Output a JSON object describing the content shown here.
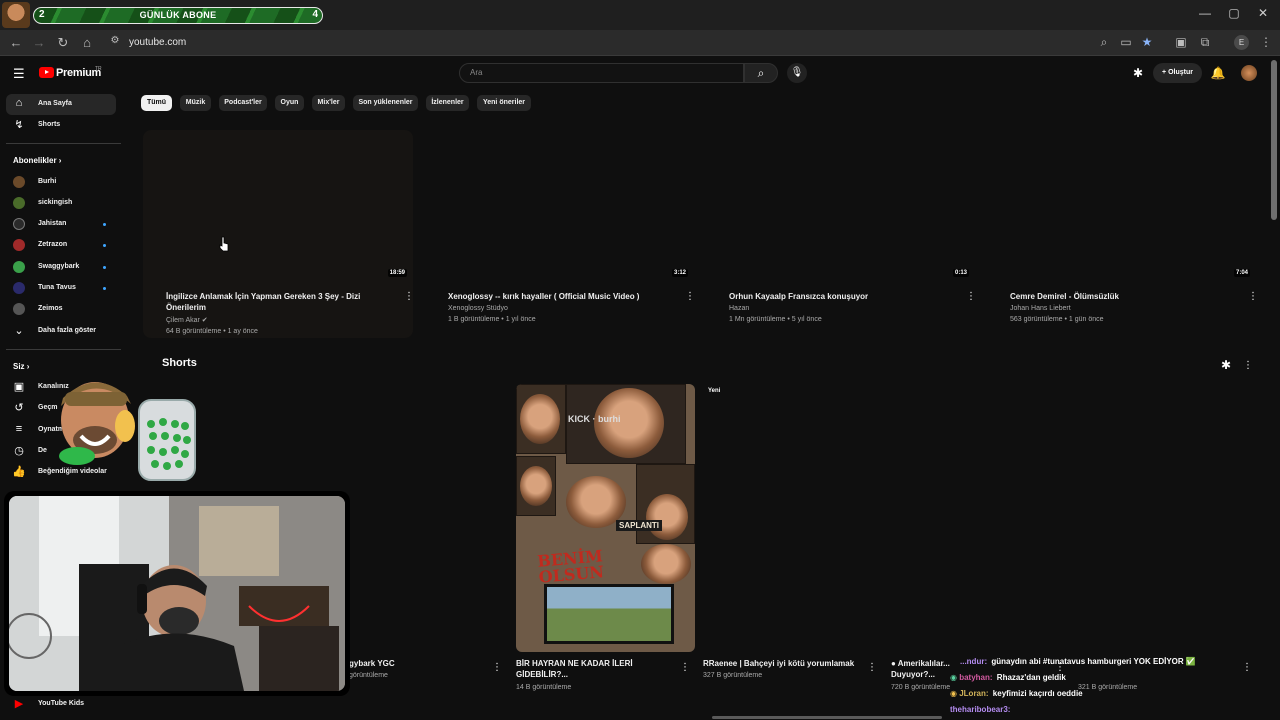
{
  "overlay": {
    "subscriber_goal": {
      "current": "2",
      "title": "GÜNLÜK ABONE",
      "goal": "4"
    }
  },
  "browser": {
    "url": "youtube.com",
    "window_controls": [
      "—",
      "▢",
      "✕"
    ]
  },
  "header": {
    "brand": "Premium",
    "region": "TR",
    "search_placeholder": "Ara",
    "create_label": "Oluştur"
  },
  "sidebar": {
    "main": [
      {
        "label": "Ana Sayfa",
        "icon": "home-icon",
        "active": true
      },
      {
        "label": "Shorts",
        "icon": "shorts-icon",
        "active": false
      }
    ],
    "subscriptions_heading": "Abonelikler",
    "subscriptions": [
      {
        "label": "Burhi",
        "color": "#6b4a2a",
        "dot": false
      },
      {
        "label": "sickingish",
        "color": "#4a6b2a",
        "dot": false
      },
      {
        "label": "Jahistan",
        "color": "#2a2a2a",
        "dot": true
      },
      {
        "label": "Zetrazon",
        "color": "#a02a2a",
        "dot": true
      },
      {
        "label": "Swaggybark",
        "color": "#3aa04a",
        "dot": true
      },
      {
        "label": "Tuna Tavus",
        "color": "#2a2a6b",
        "dot": true
      },
      {
        "label": "Zeimos",
        "color": "#555555",
        "dot": false
      }
    ],
    "show_more": "Daha fazla göster",
    "you_heading": "Siz",
    "you_items": [
      {
        "label": "Kanalınız",
        "icon": "channel-icon"
      },
      {
        "label": "Geçmiş",
        "icon": "history-icon"
      },
      {
        "label": "Oynatma listeleri",
        "icon": "playlists-icon"
      },
      {
        "label": "Daha sonra izle",
        "icon": "watch-later-icon"
      },
      {
        "label": "Beğendiğim videolar",
        "icon": "like-icon"
      }
    ],
    "you_items_visible": [
      "Kanalınız",
      "Geçm",
      "Oynatm",
      "De",
      "Beğendiğim videolar"
    ],
    "youtube_kids": "YouTube Kids"
  },
  "chips": [
    "Tümü",
    "Müzik",
    "Podcast'ler",
    "Oyun",
    "Mix'ler",
    "Son yüklenenler",
    "İzlenenler",
    "Yeni öneriler"
  ],
  "videos": [
    {
      "title": "İngilizce Anlamak İçin Yapman Gereken 3 Şey - Dizi Önerilerim",
      "channel": "Çilem Akar",
      "verified": true,
      "stats": "64 B görüntüleme • 1 ay önce",
      "duration": "18:59"
    },
    {
      "title": "Xenoglossy -- kırık hayaller (  Official Music Video )",
      "channel": "Xenoglossy Stüdyo",
      "verified": false,
      "stats": "1 B görüntüleme • 1 yıl önce",
      "duration": "3:12"
    },
    {
      "title": "Orhun Kayaalp Fransızca konuşuyor",
      "channel": "Hazan",
      "verified": false,
      "stats": "1 Mn görüntüleme • 5 yıl önce",
      "duration": "0:13"
    },
    {
      "title": "Cemre Demirel - Ölümsüzlük",
      "channel": "Johan Hans Liebert",
      "verified": false,
      "stats": "563 görüntüleme • 1 gün önce",
      "duration": "7:04"
    }
  ],
  "shorts": {
    "heading": "Shorts",
    "new_badge": "Yeni",
    "items": [
      {
        "title": "gybark YGC",
        "stats": "görüntüleme"
      },
      {
        "title": "BİR HAYRAN NE KADAR İLERİ GİDEBİLİR?...",
        "stats": "14 B görüntüleme"
      },
      {
        "title": "RRaenee | Bahçeyi iyi kötü yorumlamak",
        "stats": "327 B görüntüleme"
      },
      {
        "title": "Amerikalılar...",
        "title2": "Duyuyor?...",
        "stats": "720 B görüntüleme"
      },
      {
        "title": "",
        "stats": "321 B görüntüleme"
      }
    ],
    "thumb_texts": {
      "kick": "KICK · burhi",
      "saplanti": "SAPLANTI",
      "benim1": "BENİM",
      "benim2": "OLSUN"
    }
  },
  "chat": [
    {
      "user": "...ndur:",
      "user_color": "#b48cf0",
      "msg": "günaydın abi  #tunatavus hamburgeri YOK EDİYOR ✅"
    },
    {
      "user": "batyhan:",
      "user_color": "#d25aa0",
      "msg": "Rhazaz'dan geldik"
    },
    {
      "user": "JLoran:",
      "user_color": "#d2b45a",
      "msg": "keyfimizi kaçırdı oeddie"
    },
    {
      "user": "theharibobear3:",
      "user_color": "#b48cf0",
      "msg": ""
    }
  ],
  "colors": {
    "accent": "#ff0000",
    "bg": "#0f0f0f",
    "chip": "#272727",
    "link": "#3ea6ff"
  }
}
